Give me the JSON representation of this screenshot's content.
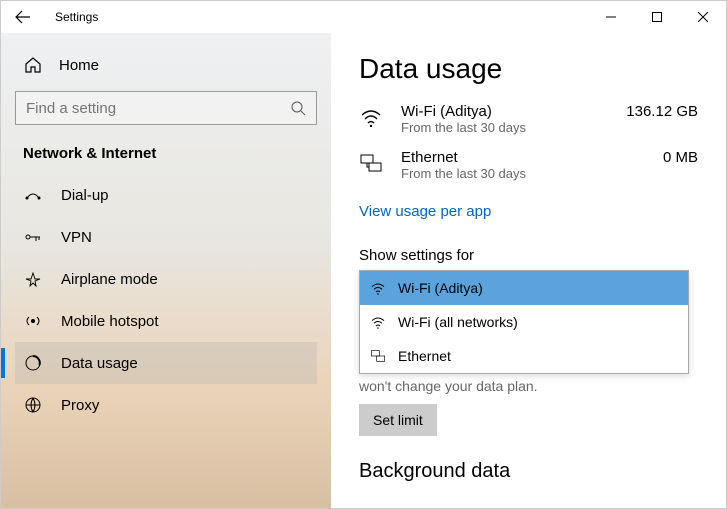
{
  "titlebar": {
    "title": "Settings"
  },
  "sidebar": {
    "home": "Home",
    "search_placeholder": "Find a setting",
    "section": "Network & Internet",
    "items": [
      {
        "label": "Dial-up"
      },
      {
        "label": "VPN"
      },
      {
        "label": "Airplane mode"
      },
      {
        "label": "Mobile hotspot"
      },
      {
        "label": "Data usage"
      },
      {
        "label": "Proxy"
      }
    ]
  },
  "content": {
    "title": "Data usage",
    "usage": [
      {
        "name": "Wi-Fi (Aditya)",
        "sub": "From the last 30 days",
        "value": "136.12 GB"
      },
      {
        "name": "Ethernet",
        "sub": "From the last 30 days",
        "value": "0 MB"
      }
    ],
    "view_link": "View usage per app",
    "show_label": "Show settings for",
    "dropdown": [
      {
        "label": "Wi-Fi (Aditya)"
      },
      {
        "label": "Wi-Fi (all networks)"
      },
      {
        "label": "Ethernet"
      }
    ],
    "plan_note": "won't change your data plan.",
    "set_limit": "Set limit",
    "background_header": "Background data"
  }
}
